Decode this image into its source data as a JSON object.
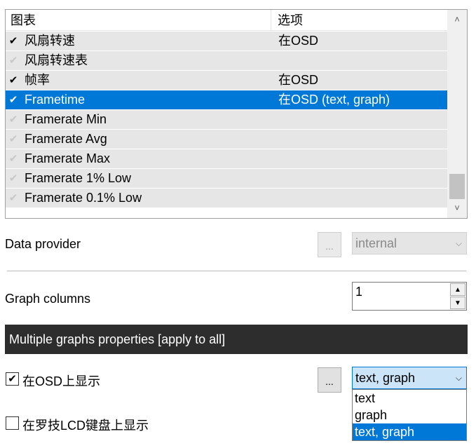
{
  "list": {
    "columns": [
      "图表",
      "选项"
    ],
    "rows": [
      {
        "checked": true,
        "name": "风扇转速",
        "option": "在OSD"
      },
      {
        "checked": false,
        "name": "风扇转速表",
        "option": ""
      },
      {
        "checked": true,
        "name": "帧率",
        "option": "在OSD"
      },
      {
        "checked": true,
        "name": "Frametime",
        "option": "在OSD (text, graph)",
        "selected": true
      },
      {
        "checked": false,
        "name": "Framerate Min",
        "option": ""
      },
      {
        "checked": false,
        "name": "Framerate Avg",
        "option": ""
      },
      {
        "checked": false,
        "name": "Framerate Max",
        "option": ""
      },
      {
        "checked": false,
        "name": "Framerate 1% Low",
        "option": ""
      },
      {
        "checked": false,
        "name": "Framerate 0.1% Low",
        "option": ""
      }
    ],
    "scroll_up": "˄",
    "scroll_down": "˅"
  },
  "data_provider": {
    "label": "Data provider",
    "button": "...",
    "value": "internal"
  },
  "graph_columns": {
    "label": "Graph columns",
    "value": "1"
  },
  "section": {
    "title": "Multiple graphs properties  [apply to all]"
  },
  "show_osd": {
    "label": "在OSD上显示",
    "checked": true,
    "button": "...",
    "value": "text, graph",
    "options": [
      "text",
      "graph",
      "text, graph"
    ],
    "selected_index": 2
  },
  "show_lcd": {
    "label": "在罗技LCD键盘上显示",
    "checked": false
  },
  "icons": {
    "check": "✔",
    "chevron": "⌵",
    "spin_up": "▲",
    "spin_down": "▼"
  },
  "colors": {
    "selection": "#0078d7",
    "section_bar": "#2d2d2d"
  }
}
